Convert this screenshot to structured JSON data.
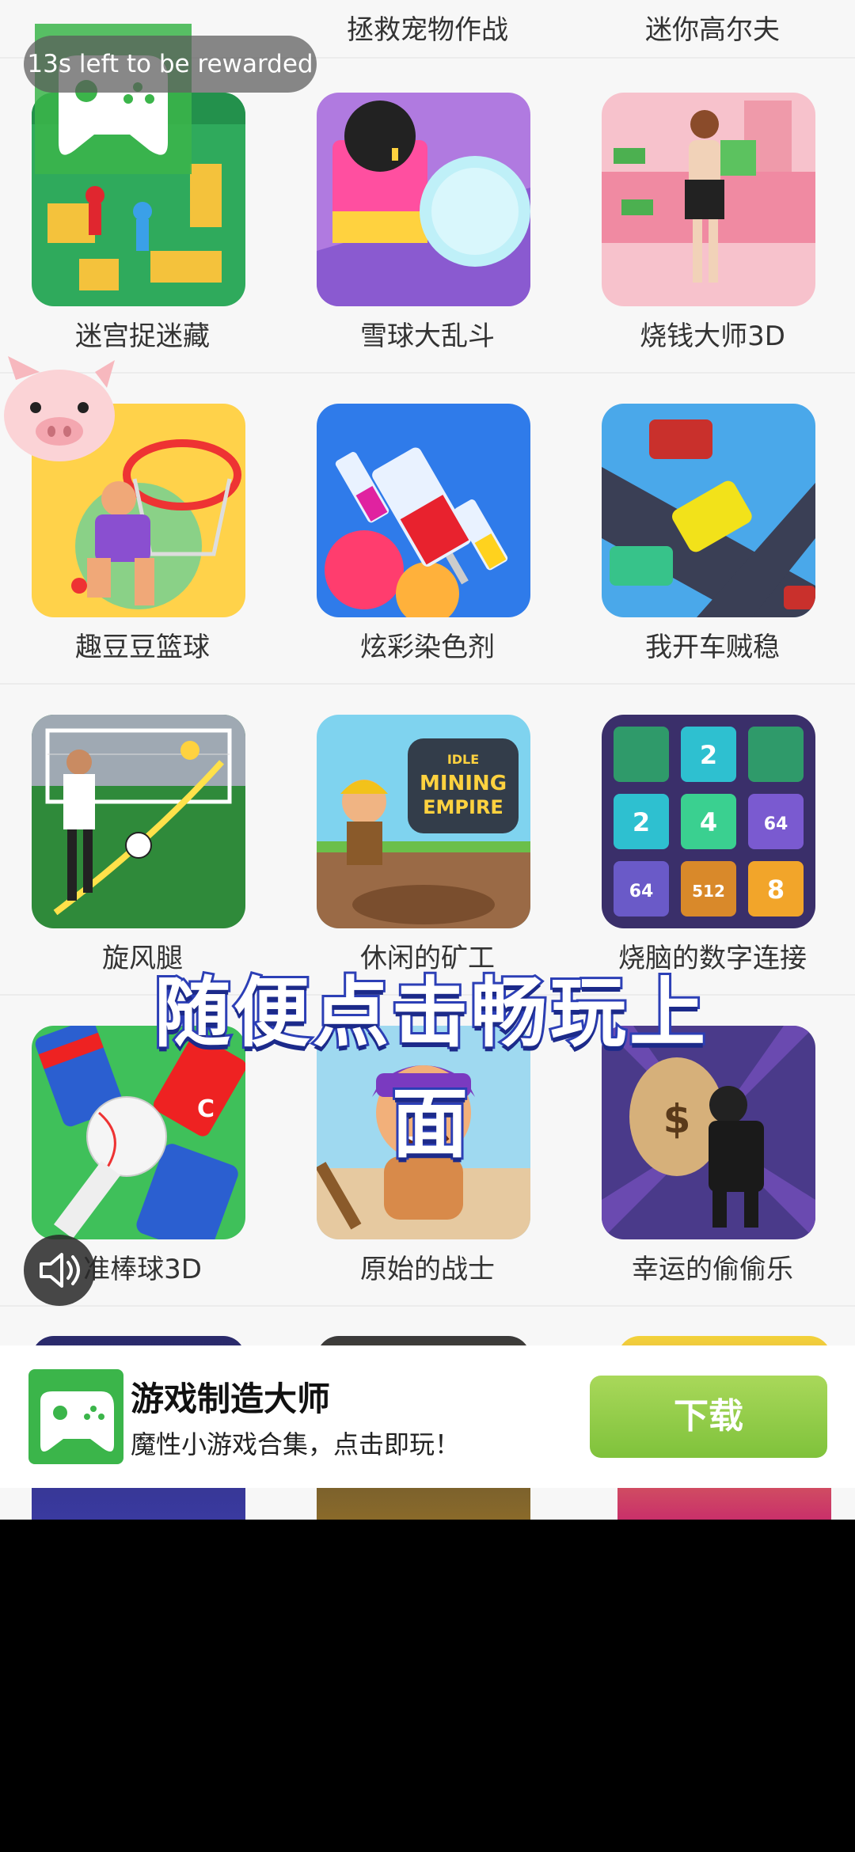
{
  "timer": {
    "text": "13s left to be rewarded"
  },
  "top_row_labels": [
    "拯救宠物作战",
    "迷你高尔夫"
  ],
  "games": [
    {
      "label": "迷宫捉迷藏"
    },
    {
      "label": "雪球大乱斗"
    },
    {
      "label": "烧钱大师3D"
    },
    {
      "label": "趣豆豆篮球"
    },
    {
      "label": "炫彩染色剂"
    },
    {
      "label": "我开车贼稳"
    },
    {
      "label": "旋风腿"
    },
    {
      "label": "休闲的矿工"
    },
    {
      "label": "烧脑的数字连接"
    },
    {
      "label": "准棒球3D"
    },
    {
      "label": "原始的战士"
    },
    {
      "label": "幸运的偷偷乐"
    }
  ],
  "thumb_text": {
    "mining_idle": "IDLE",
    "mining_title1": "MINING",
    "mining_title2": "EMPIRE",
    "tiles": [
      "2",
      "2",
      "4",
      "64",
      "64",
      "512",
      "8"
    ],
    "can_letter": "C",
    "money_sign": "$"
  },
  "banner": {
    "text": "随便点击畅玩上面"
  },
  "ad": {
    "title": "游戏制造大师",
    "description": "魔性小游戏合集，点击即玩！",
    "download_label": "下载"
  },
  "colors": {
    "download_button": "#8dc63f",
    "app_icon": "#3bb54a"
  }
}
